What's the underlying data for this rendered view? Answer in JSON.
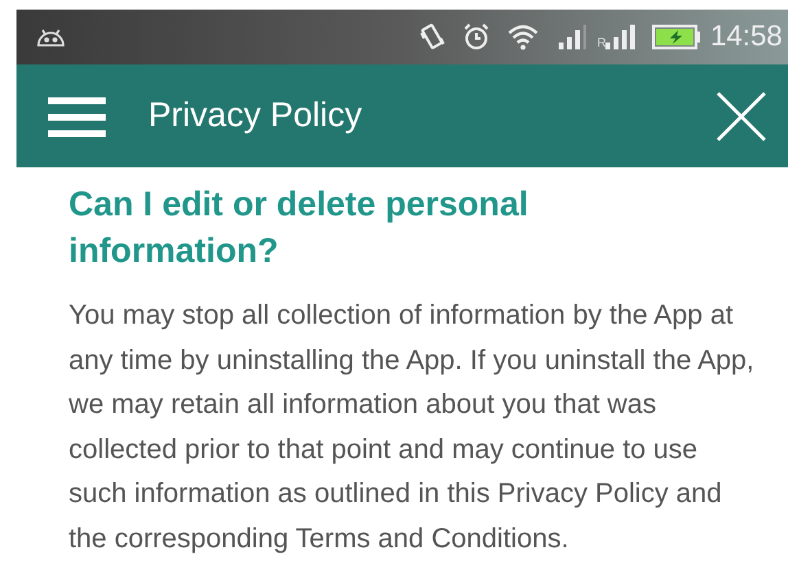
{
  "status_bar": {
    "roaming_label": "R",
    "battery_charging": true,
    "time": "14:58"
  },
  "app_bar": {
    "title": "Privacy Policy"
  },
  "section": {
    "heading": "Can I edit or delete personal information?",
    "body": "You may stop all collection of information by the App at any time by uninstalling the App. If you uninstall the App, we may retain all information about you that was collected prior to that point and may continue to use such information as outlined in this Privacy Policy and the corresponding Terms and Conditions."
  }
}
